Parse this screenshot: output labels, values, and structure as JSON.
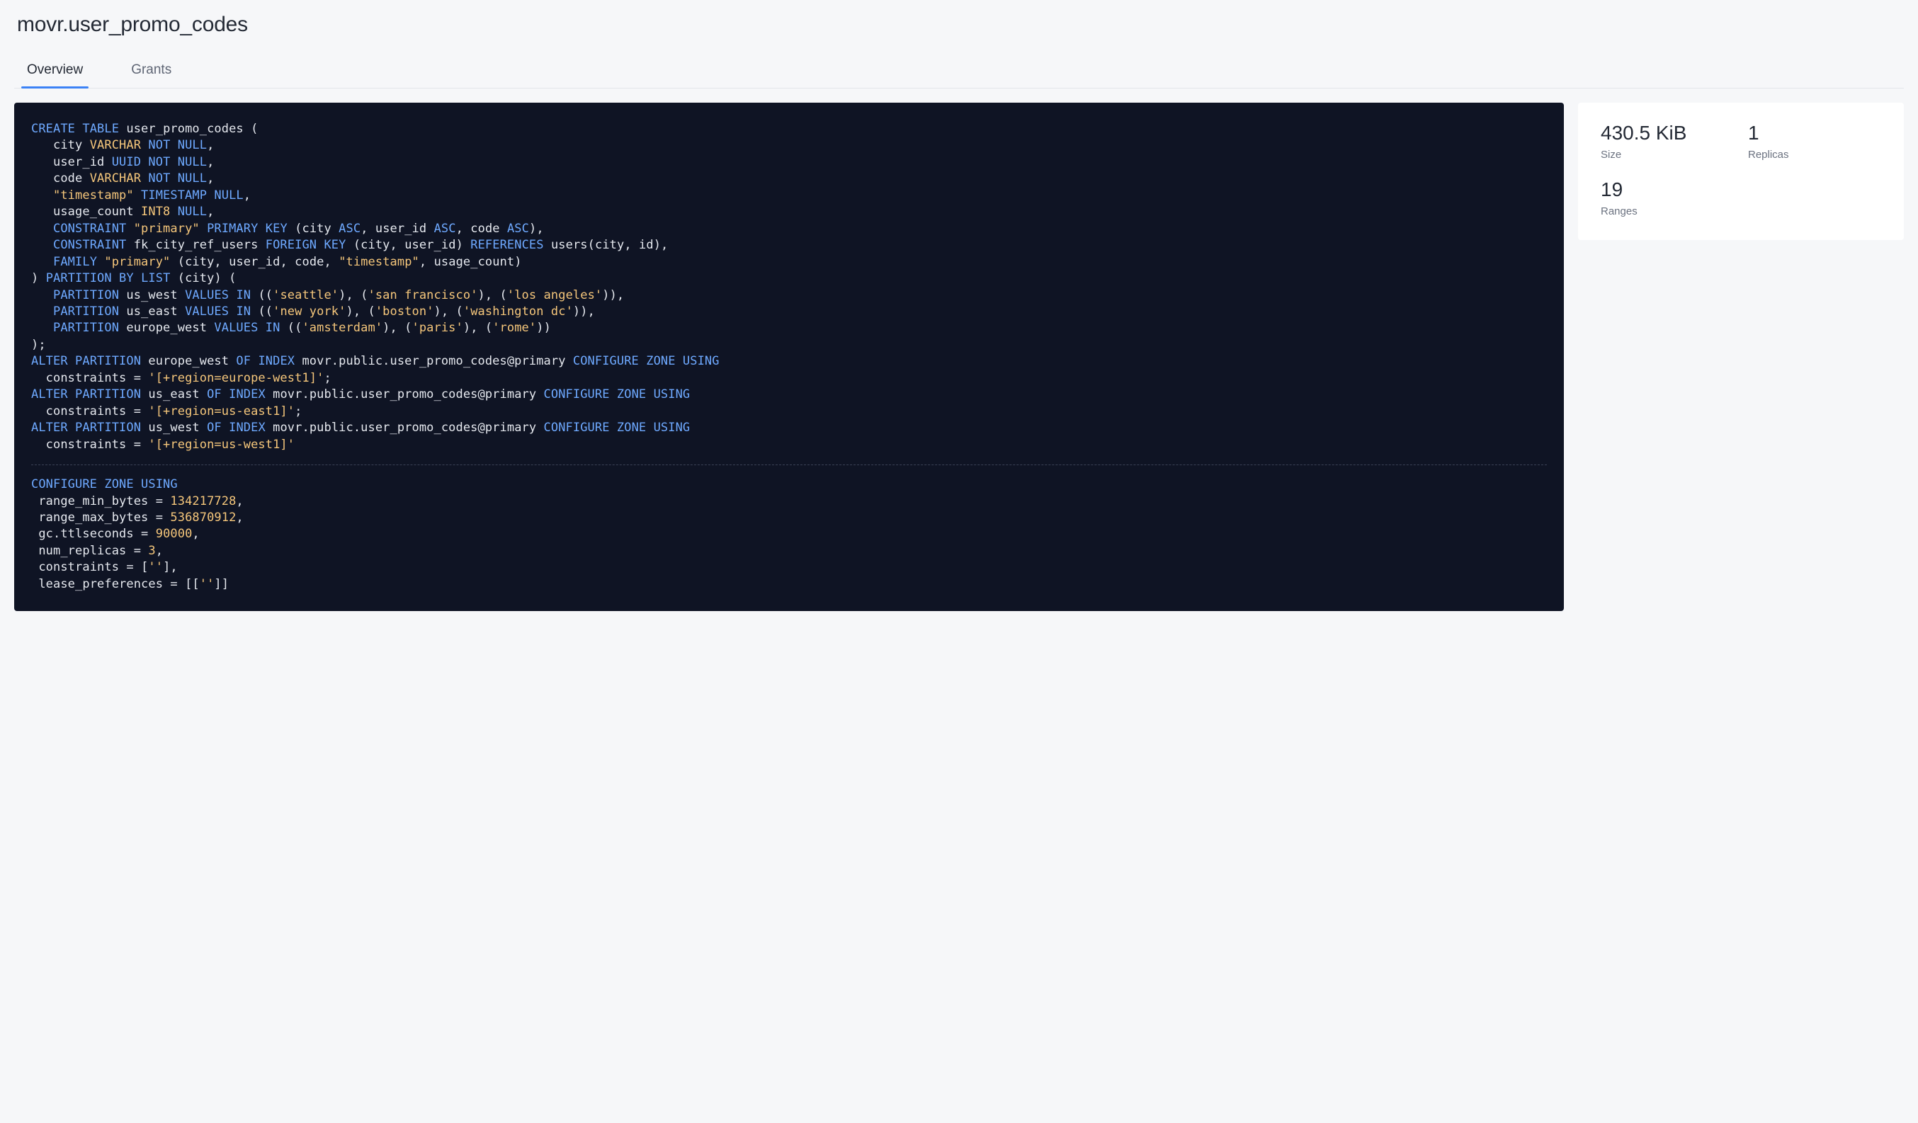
{
  "header": {
    "title": "movr.user_promo_codes"
  },
  "tabs": [
    {
      "label": "Overview",
      "active": true
    },
    {
      "label": "Grants",
      "active": false
    }
  ],
  "stats": {
    "size": {
      "value": "430.5 KiB",
      "label": "Size"
    },
    "replicas": {
      "value": "1",
      "label": "Replicas"
    },
    "ranges": {
      "value": "19",
      "label": "Ranges"
    }
  },
  "sql": {
    "tokens": [
      [
        "kw",
        "CREATE"
      ],
      [
        "sp",
        " "
      ],
      [
        "kw",
        "TABLE"
      ],
      [
        "sp",
        " "
      ],
      [
        "id",
        "user_promo_codes"
      ],
      [
        "sp",
        " "
      ],
      [
        "punct",
        "("
      ],
      [
        "nl"
      ],
      [
        "sp",
        "   "
      ],
      [
        "id",
        "city"
      ],
      [
        "sp",
        " "
      ],
      [
        "str",
        "VARCHAR"
      ],
      [
        "sp",
        " "
      ],
      [
        "kw",
        "NOT"
      ],
      [
        "sp",
        " "
      ],
      [
        "kw",
        "NULL"
      ],
      [
        "punct",
        ","
      ],
      [
        "nl"
      ],
      [
        "sp",
        "   "
      ],
      [
        "id",
        "user_id"
      ],
      [
        "sp",
        " "
      ],
      [
        "kw",
        "UUID"
      ],
      [
        "sp",
        " "
      ],
      [
        "kw",
        "NOT"
      ],
      [
        "sp",
        " "
      ],
      [
        "kw",
        "NULL"
      ],
      [
        "punct",
        ","
      ],
      [
        "nl"
      ],
      [
        "sp",
        "   "
      ],
      [
        "id",
        "code"
      ],
      [
        "sp",
        " "
      ],
      [
        "str",
        "VARCHAR"
      ],
      [
        "sp",
        " "
      ],
      [
        "kw",
        "NOT"
      ],
      [
        "sp",
        " "
      ],
      [
        "kw",
        "NULL"
      ],
      [
        "punct",
        ","
      ],
      [
        "nl"
      ],
      [
        "sp",
        "   "
      ],
      [
        "str",
        "\"timestamp\""
      ],
      [
        "sp",
        " "
      ],
      [
        "kw",
        "TIMESTAMP"
      ],
      [
        "sp",
        " "
      ],
      [
        "kw",
        "NULL"
      ],
      [
        "punct",
        ","
      ],
      [
        "nl"
      ],
      [
        "sp",
        "   "
      ],
      [
        "id",
        "usage_count"
      ],
      [
        "sp",
        " "
      ],
      [
        "str",
        "INT8"
      ],
      [
        "sp",
        " "
      ],
      [
        "kw",
        "NULL"
      ],
      [
        "punct",
        ","
      ],
      [
        "nl"
      ],
      [
        "sp",
        "   "
      ],
      [
        "kw",
        "CONSTRAINT"
      ],
      [
        "sp",
        " "
      ],
      [
        "str",
        "\"primary\""
      ],
      [
        "sp",
        " "
      ],
      [
        "kw",
        "PRIMARY"
      ],
      [
        "sp",
        " "
      ],
      [
        "kw",
        "KEY"
      ],
      [
        "sp",
        " "
      ],
      [
        "punct",
        "("
      ],
      [
        "id",
        "city"
      ],
      [
        "sp",
        " "
      ],
      [
        "kw",
        "ASC"
      ],
      [
        "punct",
        ","
      ],
      [
        "sp",
        " "
      ],
      [
        "id",
        "user_id"
      ],
      [
        "sp",
        " "
      ],
      [
        "kw",
        "ASC"
      ],
      [
        "punct",
        ","
      ],
      [
        "sp",
        " "
      ],
      [
        "id",
        "code"
      ],
      [
        "sp",
        " "
      ],
      [
        "kw",
        "ASC"
      ],
      [
        "punct",
        ")"
      ],
      [
        "punct",
        ","
      ],
      [
        "nl"
      ],
      [
        "sp",
        "   "
      ],
      [
        "kw",
        "CONSTRAINT"
      ],
      [
        "sp",
        " "
      ],
      [
        "id",
        "fk_city_ref_users"
      ],
      [
        "sp",
        " "
      ],
      [
        "kw",
        "FOREIGN"
      ],
      [
        "sp",
        " "
      ],
      [
        "kw",
        "KEY"
      ],
      [
        "sp",
        " "
      ],
      [
        "punct",
        "("
      ],
      [
        "id",
        "city"
      ],
      [
        "punct",
        ","
      ],
      [
        "sp",
        " "
      ],
      [
        "id",
        "user_id"
      ],
      [
        "punct",
        ")"
      ],
      [
        "sp",
        " "
      ],
      [
        "kw",
        "REFERENCES"
      ],
      [
        "sp",
        " "
      ],
      [
        "id",
        "users"
      ],
      [
        "punct",
        "("
      ],
      [
        "id",
        "city"
      ],
      [
        "punct",
        ","
      ],
      [
        "sp",
        " "
      ],
      [
        "id",
        "id"
      ],
      [
        "punct",
        ")"
      ],
      [
        "punct",
        ","
      ],
      [
        "nl"
      ],
      [
        "sp",
        "   "
      ],
      [
        "kw",
        "FAMILY"
      ],
      [
        "sp",
        " "
      ],
      [
        "str",
        "\"primary\""
      ],
      [
        "sp",
        " "
      ],
      [
        "punct",
        "("
      ],
      [
        "id",
        "city"
      ],
      [
        "punct",
        ","
      ],
      [
        "sp",
        " "
      ],
      [
        "id",
        "user_id"
      ],
      [
        "punct",
        ","
      ],
      [
        "sp",
        " "
      ],
      [
        "id",
        "code"
      ],
      [
        "punct",
        ","
      ],
      [
        "sp",
        " "
      ],
      [
        "str",
        "\"timestamp\""
      ],
      [
        "punct",
        ","
      ],
      [
        "sp",
        " "
      ],
      [
        "id",
        "usage_count"
      ],
      [
        "punct",
        ")"
      ],
      [
        "nl"
      ],
      [
        "punct",
        ")"
      ],
      [
        "sp",
        " "
      ],
      [
        "kw",
        "PARTITION"
      ],
      [
        "sp",
        " "
      ],
      [
        "kw",
        "BY"
      ],
      [
        "sp",
        " "
      ],
      [
        "kw",
        "LIST"
      ],
      [
        "sp",
        " "
      ],
      [
        "punct",
        "("
      ],
      [
        "id",
        "city"
      ],
      [
        "punct",
        ")"
      ],
      [
        "sp",
        " "
      ],
      [
        "punct",
        "("
      ],
      [
        "nl"
      ],
      [
        "sp",
        "   "
      ],
      [
        "kw",
        "PARTITION"
      ],
      [
        "sp",
        " "
      ],
      [
        "id",
        "us_west"
      ],
      [
        "sp",
        " "
      ],
      [
        "kw",
        "VALUES"
      ],
      [
        "sp",
        " "
      ],
      [
        "kw",
        "IN"
      ],
      [
        "sp",
        " "
      ],
      [
        "punct",
        "(("
      ],
      [
        "str",
        "'seattle'"
      ],
      [
        "punct",
        "),"
      ],
      [
        "sp",
        " "
      ],
      [
        "punct",
        "("
      ],
      [
        "str",
        "'san francisco'"
      ],
      [
        "punct",
        "),"
      ],
      [
        "sp",
        " "
      ],
      [
        "punct",
        "("
      ],
      [
        "str",
        "'los angeles'"
      ],
      [
        "punct",
        ")),"
      ],
      [
        "nl"
      ],
      [
        "sp",
        "   "
      ],
      [
        "kw",
        "PARTITION"
      ],
      [
        "sp",
        " "
      ],
      [
        "id",
        "us_east"
      ],
      [
        "sp",
        " "
      ],
      [
        "kw",
        "VALUES"
      ],
      [
        "sp",
        " "
      ],
      [
        "kw",
        "IN"
      ],
      [
        "sp",
        " "
      ],
      [
        "punct",
        "(("
      ],
      [
        "str",
        "'new york'"
      ],
      [
        "punct",
        "),"
      ],
      [
        "sp",
        " "
      ],
      [
        "punct",
        "("
      ],
      [
        "str",
        "'boston'"
      ],
      [
        "punct",
        "),"
      ],
      [
        "sp",
        " "
      ],
      [
        "punct",
        "("
      ],
      [
        "str",
        "'washington dc'"
      ],
      [
        "punct",
        ")),"
      ],
      [
        "nl"
      ],
      [
        "sp",
        "   "
      ],
      [
        "kw",
        "PARTITION"
      ],
      [
        "sp",
        " "
      ],
      [
        "id",
        "europe_west"
      ],
      [
        "sp",
        " "
      ],
      [
        "kw",
        "VALUES"
      ],
      [
        "sp",
        " "
      ],
      [
        "kw",
        "IN"
      ],
      [
        "sp",
        " "
      ],
      [
        "punct",
        "(("
      ],
      [
        "str",
        "'amsterdam'"
      ],
      [
        "punct",
        "),"
      ],
      [
        "sp",
        " "
      ],
      [
        "punct",
        "("
      ],
      [
        "str",
        "'paris'"
      ],
      [
        "punct",
        "),"
      ],
      [
        "sp",
        " "
      ],
      [
        "punct",
        "("
      ],
      [
        "str",
        "'rome'"
      ],
      [
        "punct",
        "))"
      ],
      [
        "nl"
      ],
      [
        "punct",
        ");"
      ],
      [
        "nl"
      ],
      [
        "kw",
        "ALTER"
      ],
      [
        "sp",
        " "
      ],
      [
        "kw",
        "PARTITION"
      ],
      [
        "sp",
        " "
      ],
      [
        "id",
        "europe_west"
      ],
      [
        "sp",
        " "
      ],
      [
        "kw",
        "OF"
      ],
      [
        "sp",
        " "
      ],
      [
        "kw",
        "INDEX"
      ],
      [
        "sp",
        " "
      ],
      [
        "id",
        "movr.public.user_promo_codes@primary"
      ],
      [
        "sp",
        " "
      ],
      [
        "kw",
        "CONFIGURE"
      ],
      [
        "sp",
        " "
      ],
      [
        "kw",
        "ZONE"
      ],
      [
        "sp",
        " "
      ],
      [
        "kw",
        "USING"
      ],
      [
        "nl"
      ],
      [
        "sp",
        "  "
      ],
      [
        "id",
        "constraints"
      ],
      [
        "sp",
        " "
      ],
      [
        "punct",
        "="
      ],
      [
        "sp",
        " "
      ],
      [
        "str",
        "'[+region=europe-west1]'"
      ],
      [
        "punct",
        ";"
      ],
      [
        "nl"
      ],
      [
        "kw",
        "ALTER"
      ],
      [
        "sp",
        " "
      ],
      [
        "kw",
        "PARTITION"
      ],
      [
        "sp",
        " "
      ],
      [
        "id",
        "us_east"
      ],
      [
        "sp",
        " "
      ],
      [
        "kw",
        "OF"
      ],
      [
        "sp",
        " "
      ],
      [
        "kw",
        "INDEX"
      ],
      [
        "sp",
        " "
      ],
      [
        "id",
        "movr.public.user_promo_codes@primary"
      ],
      [
        "sp",
        " "
      ],
      [
        "kw",
        "CONFIGURE"
      ],
      [
        "sp",
        " "
      ],
      [
        "kw",
        "ZONE"
      ],
      [
        "sp",
        " "
      ],
      [
        "kw",
        "USING"
      ],
      [
        "nl"
      ],
      [
        "sp",
        "  "
      ],
      [
        "id",
        "constraints"
      ],
      [
        "sp",
        " "
      ],
      [
        "punct",
        "="
      ],
      [
        "sp",
        " "
      ],
      [
        "str",
        "'[+region=us-east1]'"
      ],
      [
        "punct",
        ";"
      ],
      [
        "nl"
      ],
      [
        "kw",
        "ALTER"
      ],
      [
        "sp",
        " "
      ],
      [
        "kw",
        "PARTITION"
      ],
      [
        "sp",
        " "
      ],
      [
        "id",
        "us_west"
      ],
      [
        "sp",
        " "
      ],
      [
        "kw",
        "OF"
      ],
      [
        "sp",
        " "
      ],
      [
        "kw",
        "INDEX"
      ],
      [
        "sp",
        " "
      ],
      [
        "id",
        "movr.public.user_promo_codes@primary"
      ],
      [
        "sp",
        " "
      ],
      [
        "kw",
        "CONFIGURE"
      ],
      [
        "sp",
        " "
      ],
      [
        "kw",
        "ZONE"
      ],
      [
        "sp",
        " "
      ],
      [
        "kw",
        "USING"
      ],
      [
        "nl"
      ],
      [
        "sp",
        "  "
      ],
      [
        "id",
        "constraints"
      ],
      [
        "sp",
        " "
      ],
      [
        "punct",
        "="
      ],
      [
        "sp",
        " "
      ],
      [
        "str",
        "'[+region=us-west1]'"
      ]
    ],
    "tokens2": [
      [
        "kw",
        "CONFIGURE"
      ],
      [
        "sp",
        " "
      ],
      [
        "kw",
        "ZONE"
      ],
      [
        "sp",
        " "
      ],
      [
        "kw",
        "USING"
      ],
      [
        "nl"
      ],
      [
        "sp",
        " "
      ],
      [
        "id",
        "range_min_bytes"
      ],
      [
        "sp",
        " "
      ],
      [
        "punct",
        "="
      ],
      [
        "sp",
        " "
      ],
      [
        "lit",
        "134217728"
      ],
      [
        "punct",
        ","
      ],
      [
        "nl"
      ],
      [
        "sp",
        " "
      ],
      [
        "id",
        "range_max_bytes"
      ],
      [
        "sp",
        " "
      ],
      [
        "punct",
        "="
      ],
      [
        "sp",
        " "
      ],
      [
        "lit",
        "536870912"
      ],
      [
        "punct",
        ","
      ],
      [
        "nl"
      ],
      [
        "sp",
        " "
      ],
      [
        "id",
        "gc.ttlseconds"
      ],
      [
        "sp",
        " "
      ],
      [
        "punct",
        "="
      ],
      [
        "sp",
        " "
      ],
      [
        "lit",
        "90000"
      ],
      [
        "punct",
        ","
      ],
      [
        "nl"
      ],
      [
        "sp",
        " "
      ],
      [
        "id",
        "num_replicas"
      ],
      [
        "sp",
        " "
      ],
      [
        "punct",
        "="
      ],
      [
        "sp",
        " "
      ],
      [
        "lit",
        "3"
      ],
      [
        "punct",
        ","
      ],
      [
        "nl"
      ],
      [
        "sp",
        " "
      ],
      [
        "id",
        "constraints"
      ],
      [
        "sp",
        " "
      ],
      [
        "punct",
        "="
      ],
      [
        "sp",
        " "
      ],
      [
        "punct",
        "["
      ],
      [
        "str",
        "''"
      ],
      [
        "punct",
        "],"
      ],
      [
        "nl"
      ],
      [
        "sp",
        " "
      ],
      [
        "id",
        "lease_preferences"
      ],
      [
        "sp",
        " "
      ],
      [
        "punct",
        "="
      ],
      [
        "sp",
        " "
      ],
      [
        "punct",
        "[["
      ],
      [
        "str",
        "''"
      ],
      [
        "punct",
        "]]"
      ]
    ]
  }
}
